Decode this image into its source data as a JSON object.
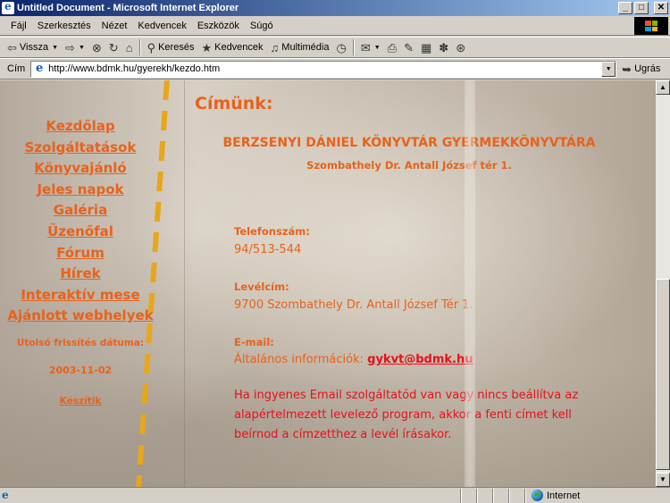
{
  "window": {
    "title": "Untitled Document - Microsoft Internet Explorer",
    "buttons": {
      "minimize": "_",
      "maximize": "□",
      "close": "✕"
    }
  },
  "menu": [
    "Fájl",
    "Szerkesztés",
    "Nézet",
    "Kedvencek",
    "Eszközök",
    "Súgó"
  ],
  "toolbar": {
    "back_label": "Vissza",
    "search_label": "Keresés",
    "favorites_label": "Kedvencek",
    "media_label": "Multimédia"
  },
  "address_bar": {
    "label": "Cím",
    "url": "http://www.bdmk.hu/gyerekh/kezdo.htm",
    "go_label": "Ugrás"
  },
  "page": {
    "nav_links": [
      "Kezdőlap",
      "Szolgáltatások",
      "Könyvajánló",
      "Jeles napok",
      "Galéria",
      "Üzenőfal",
      "Fórum",
      "Hírek",
      "Interaktív mese",
      "Ajánlott webhelyek"
    ],
    "last_updated_label": "Utolsó frissítés dátuma:",
    "last_updated_date": "2003-11-02",
    "credits_link": "Készítik",
    "address_heading": "Címünk:",
    "library_name": "BERZSENYI DÁNIEL KÖNYVTÁR GYERMEKKÖNYVTÁRA",
    "library_address": "Szombathely Dr. Antall József tér 1.",
    "phone_label": "Telefonszám:",
    "phone_value": "94/513-544",
    "mail_label": "Levélcím:",
    "mail_value": "9700 Szombathely Dr. Antall József Tér 1.",
    "email_label": "E-mail:",
    "email_info_prefix": "Általános információk:",
    "email_address": "gykvt@bdmk.hu",
    "notice": "Ha ingyenes Email szolgáltatód van vagy nincs beállítva az alapértelmezett levelező program, akkor a fenti címet kell beírnod a címzetthez a levél írásakor.",
    "accent_color": "#e8621c",
    "notice_color": "#e8101c"
  },
  "status_bar": {
    "zone": "Internet"
  }
}
